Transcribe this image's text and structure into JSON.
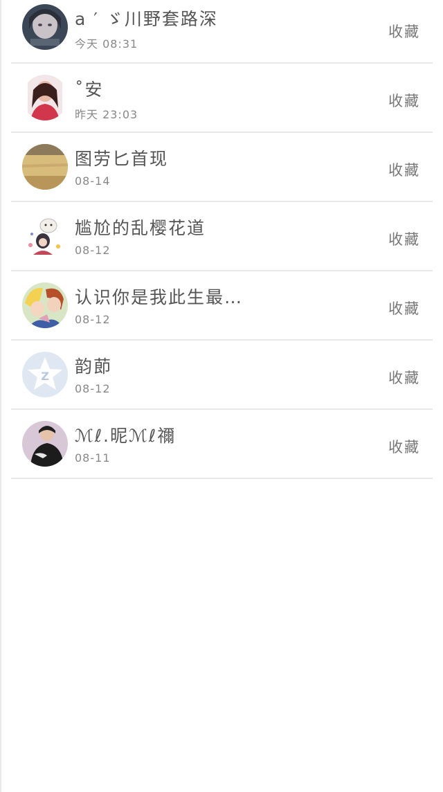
{
  "contacts": [
    {
      "name": "a ′ ゞ川野套路深",
      "time": "今天 08:31",
      "action": "收藏"
    },
    {
      "name": "˚安",
      "time": "昨天 23:03",
      "action": "收藏"
    },
    {
      "name": "图劳匕首现",
      "time": "08-14",
      "action": "收藏"
    },
    {
      "name": "尴尬的乱樱花道",
      "time": "08-12",
      "action": "收藏"
    },
    {
      "name": "认识你是我此生最…",
      "time": "08-12",
      "action": "收藏"
    },
    {
      "name": "韵莭",
      "time": "08-12",
      "action": "收藏"
    },
    {
      "name": "ℳℓ.昵ℳℓ禰",
      "time": "08-11",
      "action": "收藏"
    }
  ]
}
